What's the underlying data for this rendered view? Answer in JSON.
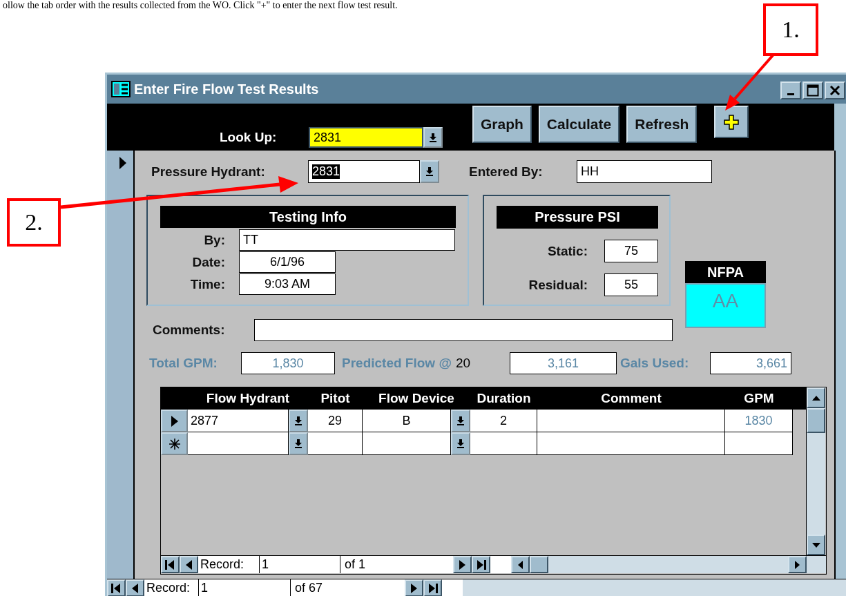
{
  "caption": "ollow the tab order with the results collected from the WO.  Click \"+\" to enter the next flow test result.",
  "callouts": [
    {
      "label": "1."
    },
    {
      "label": "2."
    }
  ],
  "window": {
    "title": "Enter Fire Flow Test Results"
  },
  "toolbar": {
    "lookup": {
      "label": "Look Up:",
      "value": "2831"
    },
    "buttons": [
      {
        "kind": "text",
        "label": "Graph"
      },
      {
        "kind": "text",
        "label": "Calculate"
      },
      {
        "kind": "text",
        "label": "Refresh"
      },
      {
        "kind": "add"
      }
    ]
  },
  "form": {
    "pressure_hydrant": {
      "label": "Pressure Hydrant:",
      "value": "2831",
      "text_selected": true
    },
    "entered_by": {
      "label": "Entered By:",
      "value": "HH"
    },
    "testing_info": {
      "title": "Testing Info",
      "fields": [
        {
          "label": "By:",
          "value": "TT"
        },
        {
          "label": "Date:",
          "value": "6/1/96"
        },
        {
          "label": "Time:",
          "value": "9:03 AM"
        }
      ]
    },
    "pressure_psi": {
      "title": "Pressure PSI",
      "fields": [
        {
          "label": "Static:",
          "value": "75"
        },
        {
          "label": "Residual:",
          "value": "55"
        }
      ]
    },
    "nfpa": {
      "title": "NFPA",
      "value": "AA"
    },
    "comments": {
      "label": "Comments:"
    },
    "totals": {
      "total_gpm": {
        "label": "Total GPM:",
        "value": "1,830"
      },
      "predicted_flow": {
        "label": "Predicted Flow @",
        "pressure": "20",
        "value": "3,161"
      },
      "gals_used": {
        "label": "Gals Used:",
        "value": "3,661"
      }
    }
  },
  "subform": {
    "columns": [
      "Flow Hydrant",
      "Pitot",
      "Flow Device",
      "Duration",
      "Comment",
      "GPM"
    ],
    "rows": [
      {
        "kind": "current",
        "flow_hydrant": "2877",
        "pitot": "29",
        "flow_device": "B",
        "duration": "2",
        "gpm": "1830"
      },
      {
        "kind": "new"
      }
    ],
    "navigation": {
      "label": "Record:",
      "value": "1",
      "of": "of 1"
    }
  },
  "navigation": {
    "label": "Record:",
    "value": "1",
    "of": "of 67"
  }
}
